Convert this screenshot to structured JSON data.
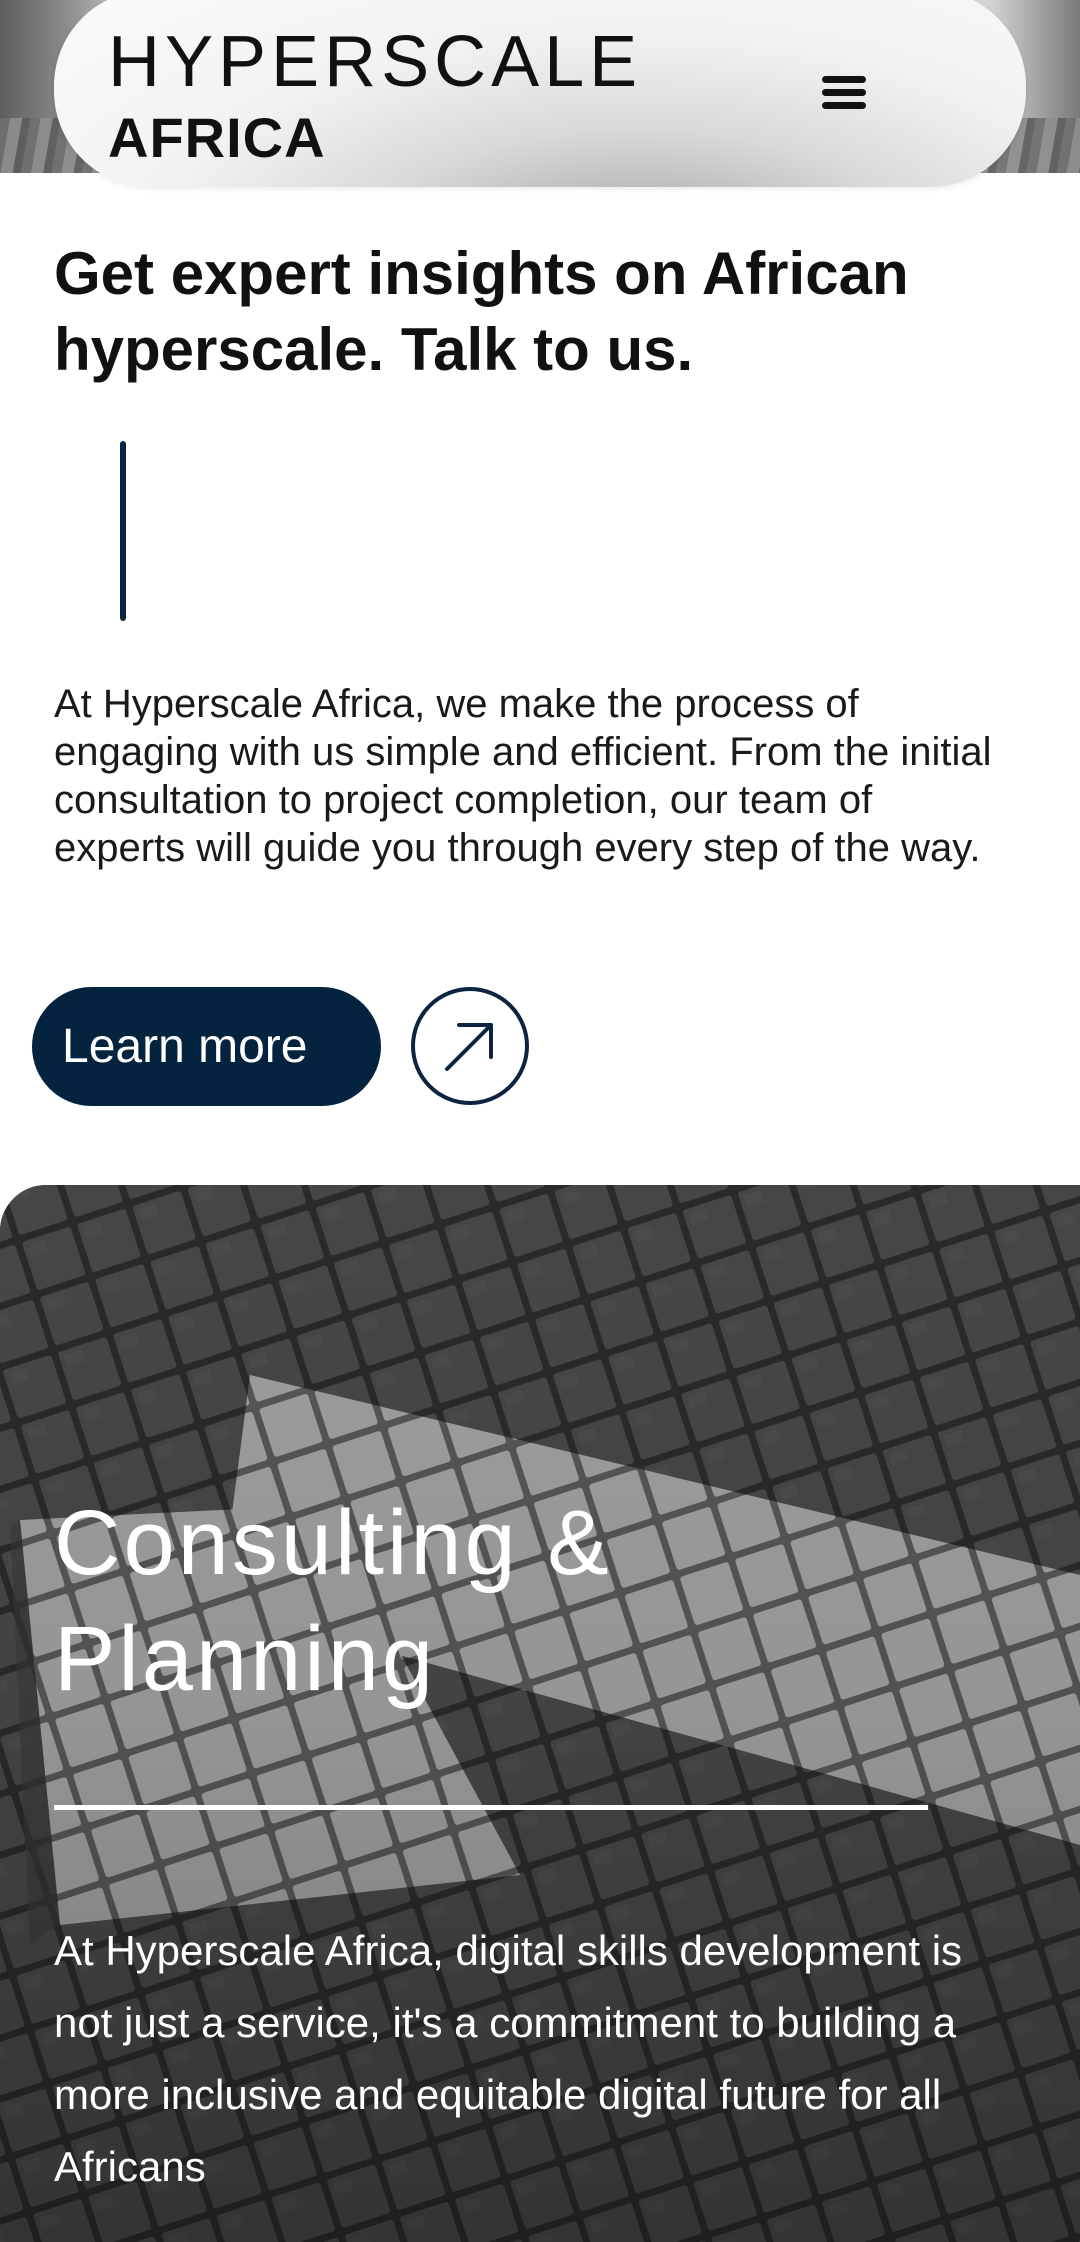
{
  "header": {
    "logo_line1": "HYPERSCALE",
    "logo_line2": "AFRICA",
    "menu_icon": "hamburger-menu-icon"
  },
  "intro": {
    "headline": "Get expert insights on African hyperscale. Talk to us.",
    "body": "At Hyperscale Africa, we make the process of engaging with us simple and efficient. From the initial consultation to project completion, our team of experts will guide you through every step of the way.",
    "cta_label": "Learn more",
    "cta_icon": "arrow-up-right-icon"
  },
  "service_card": {
    "title": "Consulting & Planning",
    "body": "At Hyperscale Africa, digital skills development is not just a service, it's a commitment to building a more inclusive and equitable digital future for all Africans",
    "background": "grey paving tiles with white arrow"
  },
  "colors": {
    "navy": "#04233f",
    "text": "#111111",
    "white": "#ffffff"
  }
}
